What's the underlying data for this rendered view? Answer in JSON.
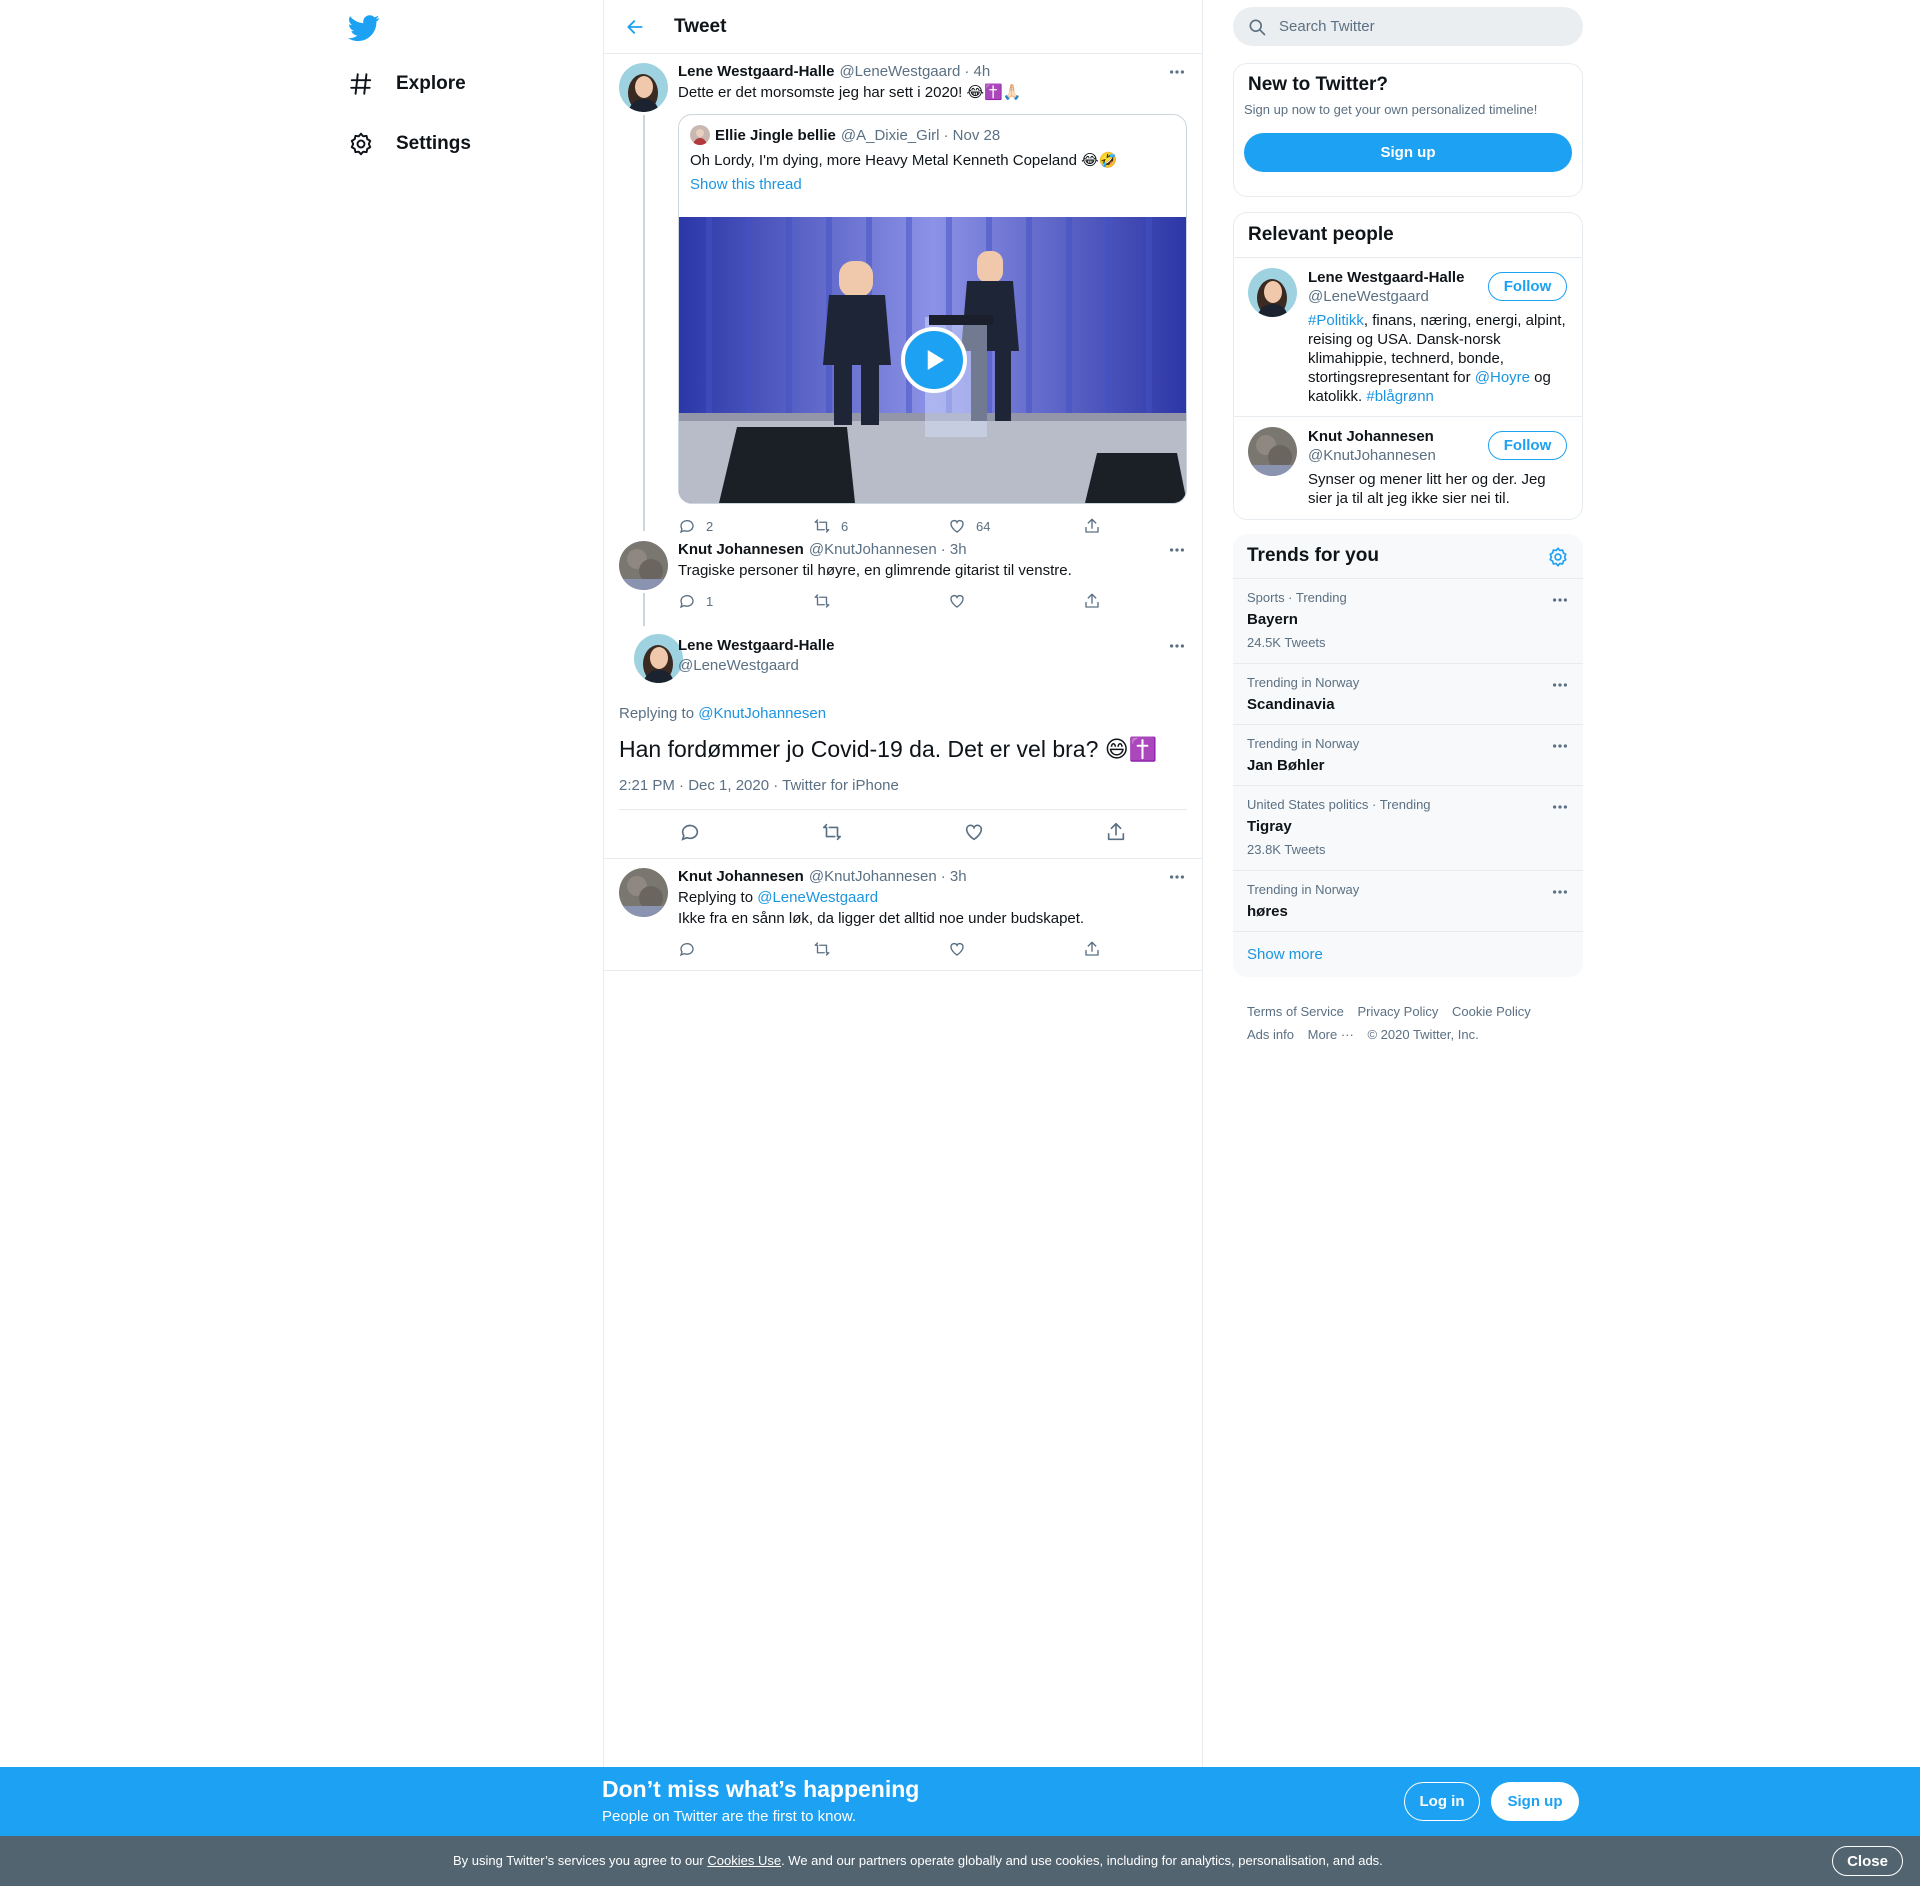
{
  "nav": {
    "explore_label": "Explore",
    "settings_label": "Settings"
  },
  "header": {
    "title": "Tweet"
  },
  "thread": {
    "tweet1": {
      "name": "Lene Westgaard-Halle",
      "handle": "@LeneWestgaard",
      "time": "· 4h",
      "text": "Dette er det morsomste jeg har sett i 2020! 😂✝️🙏🏻",
      "quote": {
        "name": "Ellie Jingle bellie",
        "handle": "@A_Dixie_Girl",
        "time": "· Nov 28",
        "text": "Oh Lordy, I'm dying, more Heavy Metal Kenneth Copeland 😂🤣",
        "show_thread": "Show this thread"
      },
      "replies": "2",
      "retweets": "6",
      "likes": "64"
    },
    "tweet2": {
      "name": "Knut Johannesen",
      "handle": "@KnutJohannesen",
      "time": "· 3h",
      "text": "Tragiske personer til høyre, en glimrende gitarist til venstre.",
      "replies": "1"
    },
    "focal": {
      "name": "Lene Westgaard-Halle",
      "handle": "@LeneWestgaard",
      "replying_prefix": "Replying to",
      "replying_to": "@KnutJohannesen",
      "text": "Han fordømmer jo Covid-19 da. Det er vel bra? 😄✝️",
      "meta": "2:21 PM · Dec 1, 2020 · Twitter for iPhone"
    },
    "tweet3": {
      "name": "Knut Johannesen",
      "handle": "@KnutJohannesen",
      "time": "· 3h",
      "replying_prefix": "Replying to",
      "replying_to": "@LeneWestgaard",
      "text": "Ikke fra en sånn løk, da ligger det alltid noe under budskapet."
    }
  },
  "search": {
    "placeholder": "Search Twitter"
  },
  "new_to_twitter": {
    "title": "New to Twitter?",
    "subtitle": "Sign up now to get your own personalized timeline!",
    "button": "Sign up"
  },
  "relevant_people": {
    "title": "Relevant people",
    "follow_label": "Follow",
    "people": [
      {
        "name": "Lene Westgaard-Halle",
        "handle": "@LeneWestgaard",
        "bio_tag1": "#Politikk",
        "bio_mid": ", finans, næring, energi, alpint, reising og USA. Dansk-norsk klimahippie, technerd, bonde, stortingsrepresentant for ",
        "bio_mention": "@Hoyre",
        "bio_mid2": " og katolikk. ",
        "bio_tag2": "#blågrønn"
      },
      {
        "name": "Knut Johannesen",
        "handle": "@KnutJohannesen",
        "bio": "Synser og mener litt her og der. Jeg sier ja til alt jeg ikke sier nei til."
      }
    ]
  },
  "trends": {
    "title": "Trends for you",
    "items": [
      {
        "category": "Sports · Trending",
        "name": "Bayern",
        "count": "24.5K Tweets"
      },
      {
        "category": "Trending in Norway",
        "name": "Scandinavia",
        "count": ""
      },
      {
        "category": "Trending in Norway",
        "name": "Jan Bøhler",
        "count": ""
      },
      {
        "category": "United States politics · Trending",
        "name": "Tigray",
        "count": "23.8K Tweets"
      },
      {
        "category": "Trending in Norway",
        "name": "høres",
        "count": ""
      }
    ],
    "show_more": "Show more"
  },
  "footer": {
    "terms": "Terms of Service",
    "privacy": "Privacy Policy",
    "cookie": "Cookie Policy",
    "ads": "Ads info",
    "more": "More ···",
    "copyright": "© 2020 Twitter, Inc."
  },
  "banner": {
    "title": "Don’t miss what’s happening",
    "subtitle": "People on Twitter are the first to know.",
    "login": "Log in",
    "signup": "Sign up"
  },
  "cookie_bar": {
    "prefix": "By using Twitter’s services you agree to our ",
    "link": "Cookies Use",
    "suffix": ". We and our partners operate globally and use cookies, including for analytics, personalisation, and ads.",
    "close": "Close"
  },
  "colors": {
    "accent": "#1da1f2",
    "link": "#1b95e0",
    "secondary_text": "#5b7083",
    "cookie_bar": "#536471"
  }
}
